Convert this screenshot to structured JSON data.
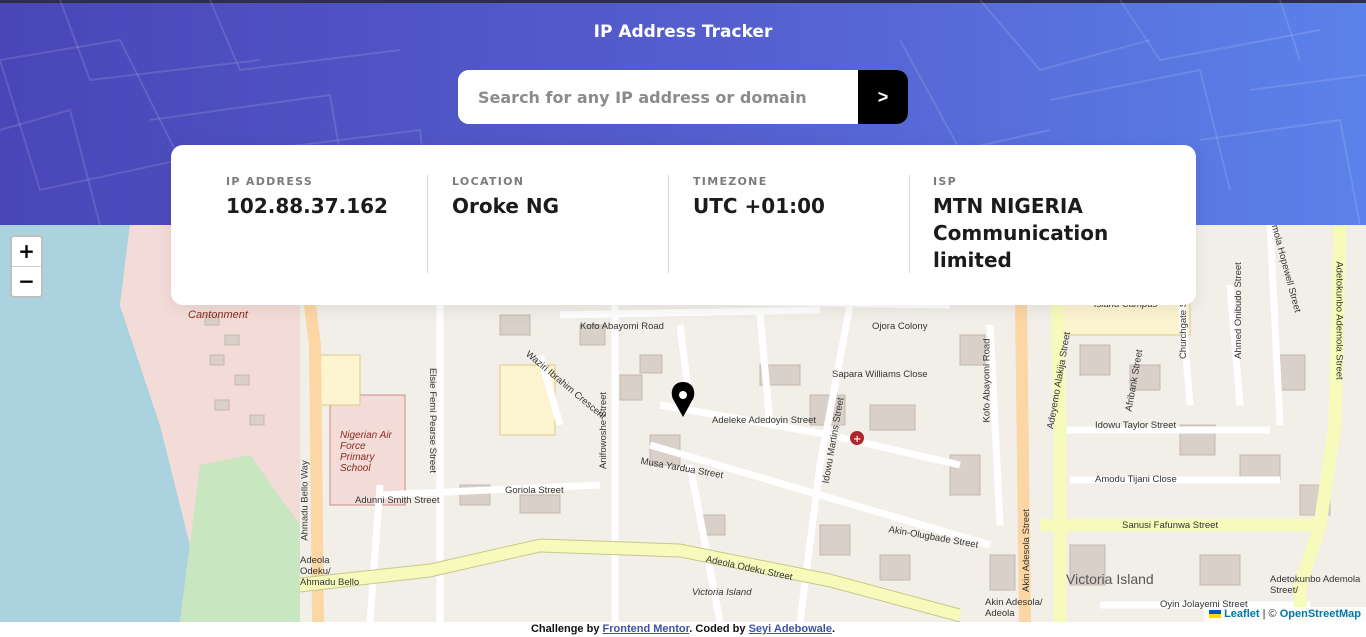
{
  "app": {
    "title": "IP Address Tracker"
  },
  "search": {
    "placeholder": "Search for any IP address or domain",
    "value": "",
    "button_glyph": ">"
  },
  "info": {
    "ip_label": "IP ADDRESS",
    "ip_value": "102.88.37.162",
    "location_label": "LOCATION",
    "location_value": "Oroke NG",
    "timezone_label": "TIMEZONE",
    "timezone_value": "UTC +01:00",
    "isp_label": "ISP",
    "isp_value_line1": "MTN NIGERIA",
    "isp_value_line2": "Communication",
    "isp_value_line3": "limited"
  },
  "map": {
    "zoom_in": "+",
    "zoom_out": "−",
    "labels": {
      "kofo": "Kofo Abayomi Road",
      "ojora": "Ojora Colony",
      "sapara": "Sapara Williams Close",
      "wazire": "Waziri Ibrahim Crescent",
      "adeleke": "Adeleke Adedoyin Street",
      "musa": "Musa Yardua Street",
      "goriola": "Goriola Street",
      "anifowoshe": "Anifowoshe Street",
      "elsie": "Elsie Femi Pearse Street",
      "ahmadu": "Ahmadu Bello Way",
      "adunni": "Adunni Smith Street",
      "adeola": "Adeola Odeku Street",
      "akin_olugbade": "Akin-Olugbade Street",
      "idowu_martins": "Idowu Martins Street",
      "kofo2": "Kofo Abayomi Road",
      "akin_adesola": "Akin Adesola Street",
      "idowu_taylor": "Idowu Taylor Street",
      "amodu": "Amodu Tijani Close",
      "sanusi": "Sanusi Fafunwa Street",
      "victoria": "Victoria Island",
      "victoria_small": "Victoria Island",
      "cantonment": "Cantonment",
      "nafps": "Nigerian Air Force Primary School",
      "adeola_ahmadu": "Adeola Odeku/ Ahmadu Bello",
      "akin_adesola_adeola": "Akin Adesola/ Adeola",
      "adetokunbo": "Adetokunbo Ademola Street/",
      "oyin": "Oyin Jolayemi Street",
      "afribank": "Afribank Street",
      "adeyemo": "Adeyemo Alakija Street",
      "churchgate": "Churchgate Street",
      "ahmed": "Ahmed Onibudo Street",
      "adetokunbo_ademola": "Adetokunbo Ademola Street",
      "island_campus": "Island Campus",
      "hospital": "Ademola Hopewell Street"
    }
  },
  "attribution": {
    "leaflet": "Leaflet",
    "sep": "| ©",
    "osm": "OpenStreetMap"
  },
  "footer": {
    "prefix": "Challenge by",
    "fm": "Frontend Mentor",
    "mid": ". Coded by",
    "author": "Seyi Adebowale",
    "suffix": "."
  },
  "colors": {
    "header_start": "#4a46b8",
    "header_end": "#5b82ea",
    "road_major": "#f6fabb",
    "road_orange": "#fcd6a4",
    "water": "#aad3df",
    "military": "#f3dcd8"
  }
}
